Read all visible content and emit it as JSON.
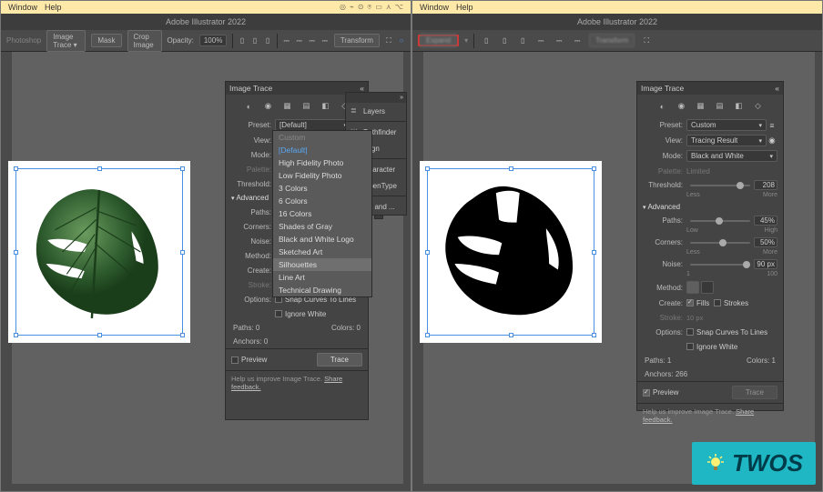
{
  "menubar": {
    "items": [
      "Window",
      "Help"
    ]
  },
  "app": {
    "title": "Adobe Illustrator 2022"
  },
  "left_toolbar": {
    "photoshop_label": "Photoshop",
    "image_trace_btn": "Image Trace",
    "mask_btn": "Mask",
    "crop_btn": "Crop Image",
    "opacity_label": "Opacity:",
    "opacity_value": "100%",
    "transform_label": "Transform"
  },
  "right_toolbar": {
    "expand_btn": "Expand",
    "transform_label": "Transform"
  },
  "image_trace": {
    "title": "Image Trace",
    "preset_label": "Preset:",
    "preset_value_left": "[Default]",
    "preset_value_right": "Custom",
    "view_label": "View:",
    "view_value_right": "Tracing Result",
    "mode_label": "Mode:",
    "mode_value_right": "Black and White",
    "palette_label": "Palette:",
    "palette_value": "Limited",
    "threshold_label": "Threshold:",
    "threshold_value": "208",
    "threshold_low": "Less",
    "threshold_high": "More",
    "advanced_label": "Advanced",
    "paths_label": "Paths:",
    "paths_value": "45%",
    "paths_low": "Low",
    "paths_high": "High",
    "corners_label": "Corners:",
    "corners_value": "50%",
    "corners_low": "Less",
    "corners_high": "More",
    "noise_label": "Noise:",
    "noise_value": "90 px",
    "noise_low": "1",
    "noise_high": "100",
    "method_label": "Method:",
    "create_label": "Create:",
    "fills_label": "Fills",
    "strokes_label": "Strokes",
    "stroke_label": "Stroke:",
    "stroke_value": "10 px",
    "options_label": "Options:",
    "snap_label": "Snap Curves To Lines",
    "ignore_label": "Ignore White",
    "info_paths_label": "Paths:",
    "info_paths_left": "0",
    "info_paths_right": "1",
    "info_colors_label": "Colors:",
    "info_colors_left": "0",
    "info_colors_right": "1",
    "info_anchors_label": "Anchors:",
    "info_anchors_left": "0",
    "info_anchors_right": "266",
    "preview_label": "Preview",
    "trace_btn": "Trace",
    "help_prefix": "Help us improve Image Trace. ",
    "help_link": "Share feedback."
  },
  "preset_dropdown": {
    "items": [
      "Custom",
      "[Default]",
      "High Fidelity Photo",
      "Low Fidelity Photo",
      "3 Colors",
      "6 Colors",
      "16 Colors",
      "Shades of Gray",
      "Black and White Logo",
      "Sketched Art",
      "Silhouettes",
      "Line Art",
      "Technical Drawing"
    ]
  },
  "dock": {
    "layers": "Layers",
    "pathfinder": "Pathfinder",
    "align": "Align",
    "character": "Character",
    "opentype": "OpenType",
    "threeD": "3D and ..."
  },
  "twos": {
    "text": "TWOS"
  }
}
